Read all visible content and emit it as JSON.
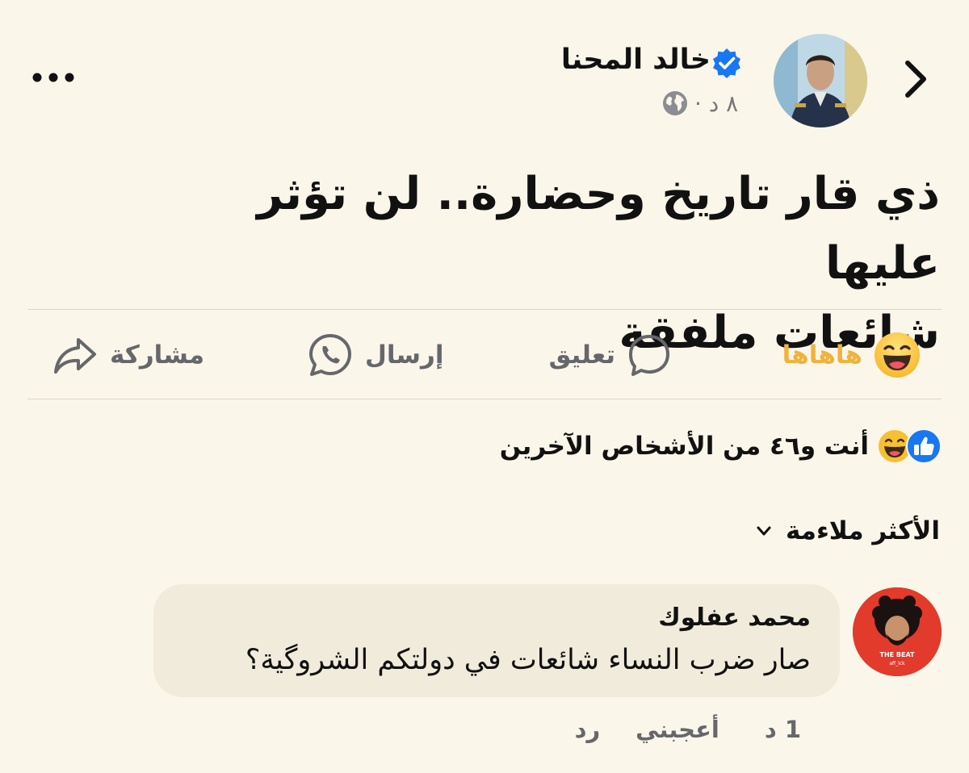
{
  "header": {
    "author_name": "خالد المحنا",
    "post_time": "٨ د ·",
    "verified_color": "#1877f2"
  },
  "post": {
    "text_line1": "ذي قار تاريخ وحضارة.. لن تؤثر عليها",
    "text_line2": "شائعات ملفقة"
  },
  "actions": {
    "reaction_label": "هاهاها",
    "comment_label": "تعليق",
    "send_label": "إرسال",
    "share_label": "مشاركة",
    "reaction_color": "#f0b33b"
  },
  "reactions_summary": "أنت و٤٦ من الأشخاص الآخرين",
  "sort_label": "الأكثر ملاءمة",
  "comment": {
    "author": "محمد عفلوك",
    "text": "صار ضرب النساء شائعات في دولتكم الشروگية؟",
    "time": "1 د",
    "like_label": "أعجبني",
    "reply_label": "رد",
    "avatar_text_1": "THE BEAT",
    "avatar_text_2": "aff_lck"
  }
}
